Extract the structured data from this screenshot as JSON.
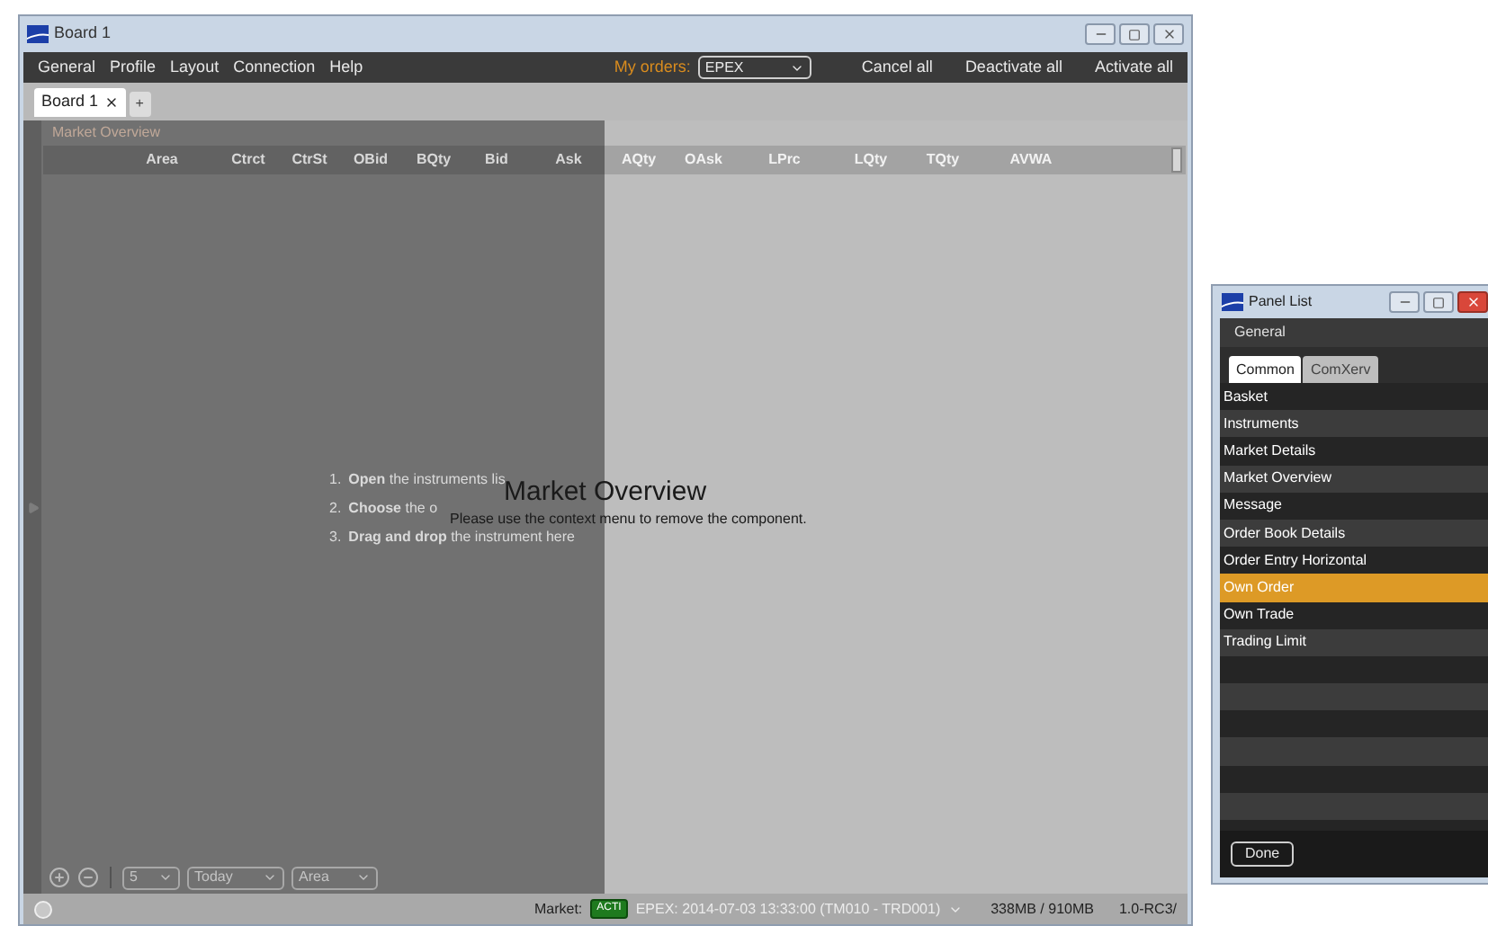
{
  "window": {
    "title": "Board 1"
  },
  "menu": [
    "General",
    "Profile",
    "Layout",
    "Connection",
    "Help"
  ],
  "orders": {
    "label": "My orders:",
    "exchange": "EPEX",
    "buttons": [
      "Cancel all",
      "Deactivate all",
      "Activate all"
    ]
  },
  "board_tabs": [
    {
      "label": "Board 1",
      "selected": true
    }
  ],
  "add_tab": "+",
  "panel": {
    "title": "Market Overview",
    "columns": [
      "Area",
      "Ctrct",
      "CtrSt",
      "OBid",
      "BQty",
      "Bid",
      "Ask",
      "AQty",
      "OAsk",
      "LPrc",
      "LQty",
      "TQty",
      "AVWA"
    ],
    "instructions": [
      {
        "number": "1.",
        "text": "**Open** the instruments lis"
      },
      {
        "number": "2.",
        "text": "**Choose** the o"
      },
      {
        "number": "3.",
        "text": "**Drag and drop** the instrument here"
      }
    ],
    "toolbar": {
      "rows": "5",
      "period": "Today",
      "grouping": "Area"
    }
  },
  "drag_preview": {
    "title": "Market Overview",
    "message": "Please use the context menu to remove the component."
  },
  "status_bar": {
    "market_label": "Market:",
    "badge": "ACTI",
    "session": "EPEX: 2014-07-03 13:33:00 (TM010 - TRD001)",
    "memory": "338MB / 910MB",
    "version": "1.0-RC3/"
  },
  "panel_list": {
    "title": "Panel List",
    "menu": "General",
    "tabs": [
      {
        "label": "Common",
        "selected": true
      },
      {
        "label": "ComXerv",
        "selected": false
      }
    ],
    "items": [
      {
        "label": "Basket",
        "selected": false
      },
      {
        "label": "Instruments",
        "selected": false
      },
      {
        "label": "Market Details",
        "selected": false
      },
      {
        "label": "Market Overview",
        "selected": false
      },
      {
        "label": "Message",
        "selected": false
      },
      {
        "label": "Order Book Details",
        "selected": false
      },
      {
        "label": "Order Entry Horizontal",
        "selected": false
      },
      {
        "label": "Own Order",
        "selected": true
      },
      {
        "label": "Own Trade",
        "selected": false
      },
      {
        "label": "Trading Limit",
        "selected": false
      }
    ],
    "button": "Done"
  }
}
